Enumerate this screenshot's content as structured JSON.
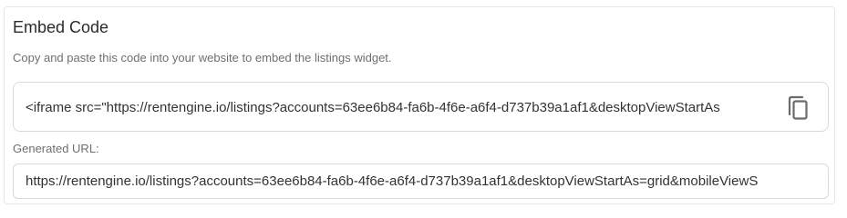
{
  "embed": {
    "title": "Embed Code",
    "description": "Copy and paste this code into your website to embed the listings widget.",
    "code": "<iframe src=\"https://rentengine.io/listings?accounts=63ee6b84-fa6b-4f6e-a6f4-d737b39a1af1&desktopViewStartAs",
    "copy_icon": "copy-icon"
  },
  "generated": {
    "label": "Generated URL:",
    "url": "https://rentengine.io/listings?accounts=63ee6b84-fa6b-4f6e-a6f4-d737b39a1af1&desktopViewStartAs=grid&mobileViewS"
  },
  "colors": {
    "text_primary": "#2b2b2b",
    "text_muted": "#6f6f6f",
    "border": "#d9d9d9",
    "icon": "#6b6b6b"
  }
}
